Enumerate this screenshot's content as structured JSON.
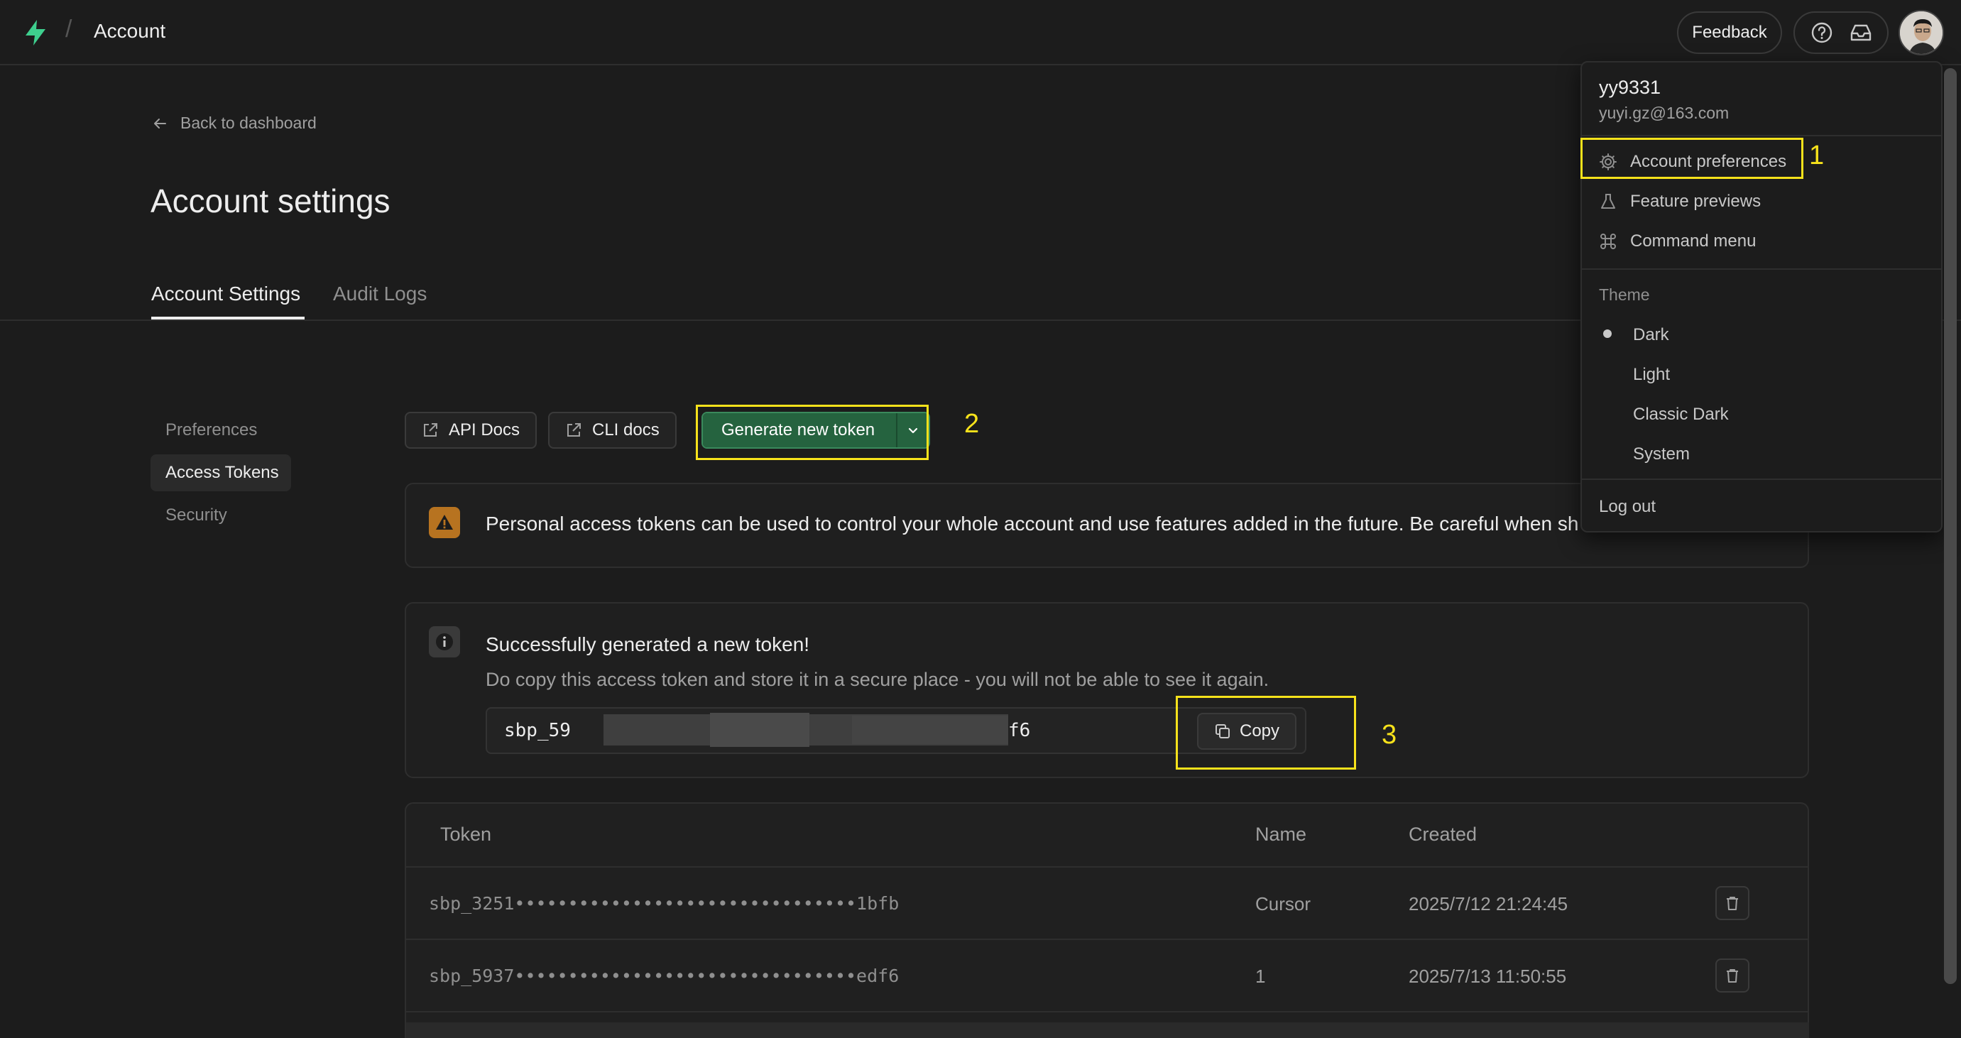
{
  "topbar": {
    "crumb_sep": "/",
    "title": "Account",
    "feedback_label": "Feedback"
  },
  "header": {
    "back_label": "Back to dashboard",
    "page_title": "Account settings",
    "tabs": [
      {
        "label": "Account Settings",
        "active": true
      },
      {
        "label": "Audit Logs",
        "active": false
      }
    ]
  },
  "sidenav": {
    "items": [
      {
        "label": "Preferences",
        "active": false
      },
      {
        "label": "Access Tokens",
        "active": true
      },
      {
        "label": "Security",
        "active": false
      }
    ]
  },
  "toolbar": {
    "api_docs_label": "API Docs",
    "cli_docs_label": "CLI docs",
    "generate_label": "Generate new token"
  },
  "warning": {
    "text": "Personal access tokens can be used to control your whole account and use features added in the future. Be careful when sh"
  },
  "success": {
    "title": "Successfully generated a new token!",
    "description": "Do copy this access token and store it in a secure place - you will not be able to see it again.",
    "token_prefix": "sbp_59",
    "token_suffix": "f6",
    "copy_label": "Copy"
  },
  "table": {
    "columns": [
      "Token",
      "Name",
      "Created"
    ],
    "rows": [
      {
        "token": "sbp_3251••••••••••••••••••••••••••••••••1bfb",
        "name": "Cursor",
        "created": "2025/7/12 21:24:45"
      },
      {
        "token": "sbp_5937••••••••••••••••••••••••••••••••edf6",
        "name": "1",
        "created": "2025/7/13 11:50:55"
      }
    ]
  },
  "menu": {
    "username": "yy9331",
    "email": "yuyi.gz@163.com",
    "items": [
      {
        "label": "Account preferences",
        "icon": "gear-icon"
      },
      {
        "label": "Feature previews",
        "icon": "flask-icon"
      },
      {
        "label": "Command menu",
        "icon": "command-icon"
      }
    ],
    "theme_label": "Theme",
    "theme_options": [
      "Dark",
      "Light",
      "Classic Dark",
      "System"
    ],
    "selected_theme": "Dark",
    "logout_label": "Log out"
  },
  "annotations": {
    "n1": "1",
    "n2": "2",
    "n3": "3",
    "color": "#f7e21b"
  },
  "colors": {
    "background": "#1c1c1c",
    "brand_green": "#3ecf8e",
    "button_green": "#25633f",
    "warning_orange": "#b77320"
  }
}
